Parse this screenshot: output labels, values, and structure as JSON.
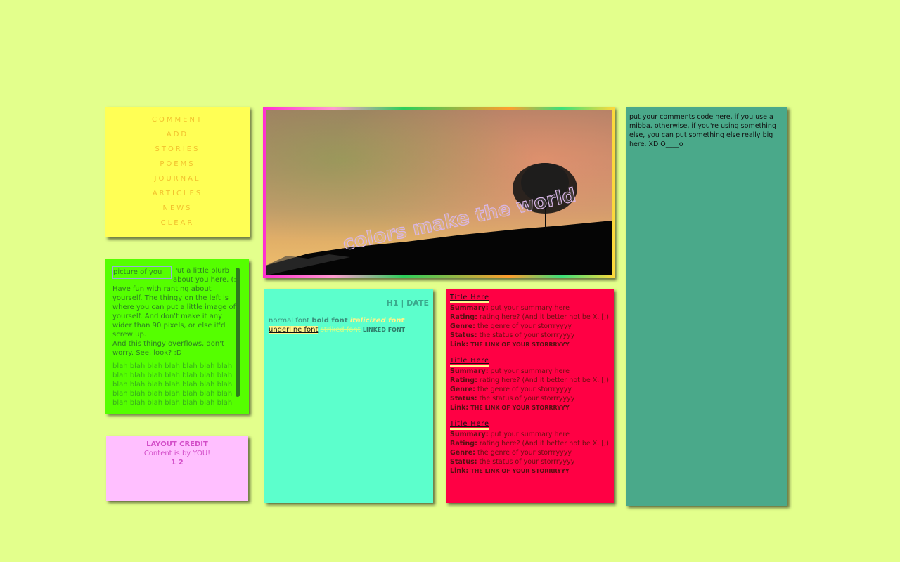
{
  "nav": {
    "links": [
      "COMMENT",
      "ADD",
      "STORIES",
      "POEMS",
      "JOURNAL",
      "ARTICLES",
      "NEWS",
      "CLEAR"
    ]
  },
  "about": {
    "image_alt": "picture of you",
    "blurb": "Put a little blurb about you here. (: Have fun with ranting about yourself. The thingy on the left is where you can put a little image of yourself. And don't make it any wider than 90 pixels, or else it'd screw up.",
    "overflow_note": "And this thingy overflows, don't worry. See, look? :D",
    "filler": "blah blah blah blah blah blah blah blah blah blah blah blah blah blah blah blah blah blah blah blah blah blah blah blah blah blah blah blah blah blah blah blah blah blah blah blah blah blah blah blah blah blah blah blah blah blah blah blah blah blah"
  },
  "credit": {
    "title": "LAYOUT CREDIT",
    "line": "Content is by YOU!",
    "pages": "1 2"
  },
  "header": {
    "overlay_text": "colors make the world"
  },
  "content": {
    "heading": "H1 | DATE",
    "normal": "normal font",
    "bold": "bold font",
    "italic": "italicized font",
    "underline": "underline font",
    "strike": "striked font",
    "link": "LINKED FONT"
  },
  "stories": {
    "labels": {
      "summary": "Summary:",
      "rating": "Rating:",
      "genre": "Genre:",
      "status": "Status:",
      "link": "Link:"
    },
    "items": [
      {
        "title": "Title Here",
        "summary": "put your summary here",
        "rating": "rating here? (And it better not be X. [;)",
        "genre": "the genre of your storrryyyy",
        "status": "the status of your storrryyyy",
        "link": "THE LINK OF YOUR STORRRYYY"
      },
      {
        "title": "Title Here",
        "summary": "put your summary here",
        "rating": "rating here? (And it better not be X. [;)",
        "genre": "the genre of your storrryyyy",
        "status": "the status of your storrryyyy",
        "link": "THE LINK OF YOUR STORRRYYY"
      },
      {
        "title": "Title Here",
        "summary": "put your summary here",
        "rating": "rating here? (And it better not be X. [;)",
        "genre": "the genre of your storrryyyy",
        "status": "the status of your storrryyyy",
        "link": "THE LINK OF YOUR STORRRYYY"
      }
    ]
  },
  "comments": {
    "text": "put your comments code here, if you use a mibba. otherwise, if you're using something else, you can put something else really big here. XD O____o"
  },
  "colors": {
    "background": "#e3ff8c",
    "nav": "#ffff55",
    "about": "#55ff00",
    "credit": "#ffbfff",
    "content": "#5cffcc",
    "stories": "#ff0044",
    "comments": "#4aa98a"
  }
}
